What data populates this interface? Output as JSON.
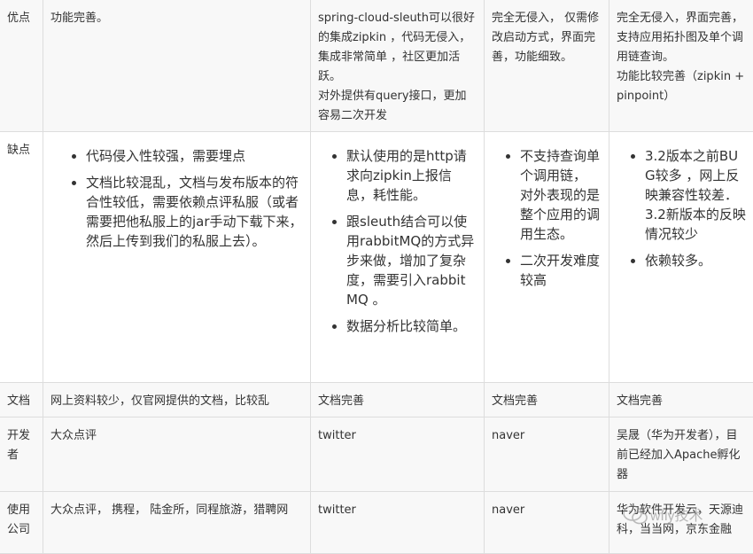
{
  "rows": {
    "pros": {
      "label": "优点",
      "c1": "功能完善。",
      "c2": [
        "spring-cloud-sleuth可以很好的集成zipkin ，代码无侵入，集成非常简单 ，社区更加活跃。",
        "对外提供有query接口，更加容易二次开发"
      ],
      "c3": "完全无侵入， 仅需修改启动方式，界面完善，功能细致。",
      "c4": [
        "完全无侵入，界面完善，支持应用拓扑图及单个调用链查询。",
        "功能比较完善（zipkin + pinpoint）"
      ]
    },
    "cons": {
      "label": "缺点",
      "c1": [
        "代码侵入性较强，需要埋点",
        "文档比较混乱，文档与发布版本的符合性较低，需要依赖点评私服（或者需要把他私服上的jar手动下载下来，然后上传到我们的私服上去）。"
      ],
      "c2": [
        "默认使用的是http请求向zipkin上报信息，耗性能。",
        "跟sleuth结合可以使用rabbitMQ的方式异步来做，增加了复杂度，需要引入rabbitMQ 。",
        "数据分析比较简单。"
      ],
      "c3": [
        "不支持查询单个调用链， 对外表现的是整个应用的调用生态。",
        "二次开发难度较高"
      ],
      "c4": [
        "3.2版本之前BUG较多 ，网上反映兼容性较差．3.2新版本的反映情况较少",
        "依赖较多。"
      ]
    },
    "docs": {
      "label": "文档",
      "c1": "网上资料较少，仅官网提供的文档，比较乱",
      "c2": "文档完善",
      "c3": "文档完善",
      "c4": "文档完善"
    },
    "dev": {
      "label": "开发者",
      "c1": "大众点评",
      "c2": "twitter",
      "c3": "naver",
      "c4": "吴晟（华为开发者），目前已经加入Apache孵化器"
    },
    "use": {
      "label": "使用公司",
      "c1": "大众点评， 携程， 陆金所，同程旅游，猎聘网",
      "c2": "twitter",
      "c3": "naver",
      "c4": "华为软件开发云，天源迪科，当当网，京东金融"
    }
  },
  "watermark": {
    "text": "wfly技术",
    "icon": "wechat-icon"
  }
}
